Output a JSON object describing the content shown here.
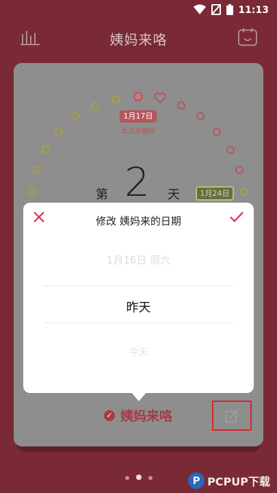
{
  "status": {
    "time": "11:13"
  },
  "header": {
    "title": "姨妈来咯"
  },
  "calendar": {
    "day_prefix": "第",
    "day_number": "2",
    "day_suffix": "天",
    "period_start_marker": "1月17日",
    "period_start_caption": "本次来姨妈",
    "next_marker": "1月24日"
  },
  "dialog": {
    "title": "修改 姨妈来的日期",
    "options": [
      "1月16日 周六",
      "昨天",
      "今天"
    ],
    "selected_index": 1
  },
  "bottom": {
    "label": "姨妈来咯"
  },
  "pager": {
    "count": 3,
    "active": 1
  },
  "watermark": {
    "text": "PCPUP下载",
    "logo": "P"
  },
  "colors": {
    "background": "#7a2a34",
    "accent": "#e0405a",
    "card": "#8e8e8e"
  }
}
